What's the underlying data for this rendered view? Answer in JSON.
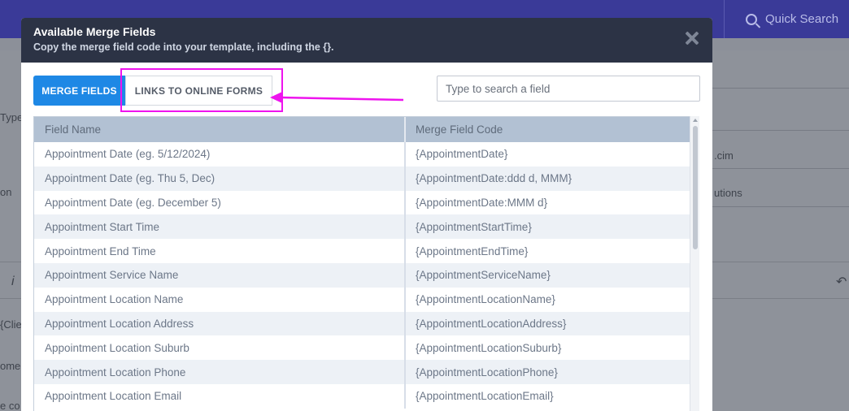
{
  "background": {
    "quick_search": "Quick Search",
    "left_fragments": [
      "Type",
      "on",
      "i",
      "{Clie",
      "ome",
      "e co"
    ],
    "right_fragments": [
      ".cim",
      "utions"
    ]
  },
  "modal": {
    "title": "Available Merge Fields",
    "subtitle": "Copy the merge field code into your template, including the {}.",
    "tabs": {
      "merge_fields": "MERGE FIELDS",
      "links_to_online_forms": "LINKS TO ONLINE FORMS"
    },
    "search": {
      "placeholder": "Type to search a field"
    },
    "table": {
      "columns": [
        "Field Name",
        "Merge Field Code"
      ],
      "rows": [
        [
          "Appointment Date (eg. 5/12/2024)",
          "{AppointmentDate}"
        ],
        [
          "Appointment Date (eg. Thu 5, Dec)",
          "{AppointmentDate:ddd d, MMM}"
        ],
        [
          "Appointment Date (eg. December 5)",
          "{AppointmentDate:MMM d}"
        ],
        [
          "Appointment Start Time",
          "{AppointmentStartTime}"
        ],
        [
          "Appointment End Time",
          "{AppointmentEndTime}"
        ],
        [
          "Appointment Service Name",
          "{AppointmentServiceName}"
        ],
        [
          "Appointment Location Name",
          "{AppointmentLocationName}"
        ],
        [
          "Appointment Location Address",
          "{AppointmentLocationAddress}"
        ],
        [
          "Appointment Location Suburb",
          "{AppointmentLocationSuburb}"
        ],
        [
          "Appointment Location Phone",
          "{AppointmentLocationPhone}"
        ],
        [
          "Appointment Location Email",
          "{AppointmentLocationEmail}"
        ]
      ]
    }
  },
  "colors": {
    "accent": "#1e88e5",
    "annotation": "#ee14ee",
    "header": "#2c3345"
  }
}
